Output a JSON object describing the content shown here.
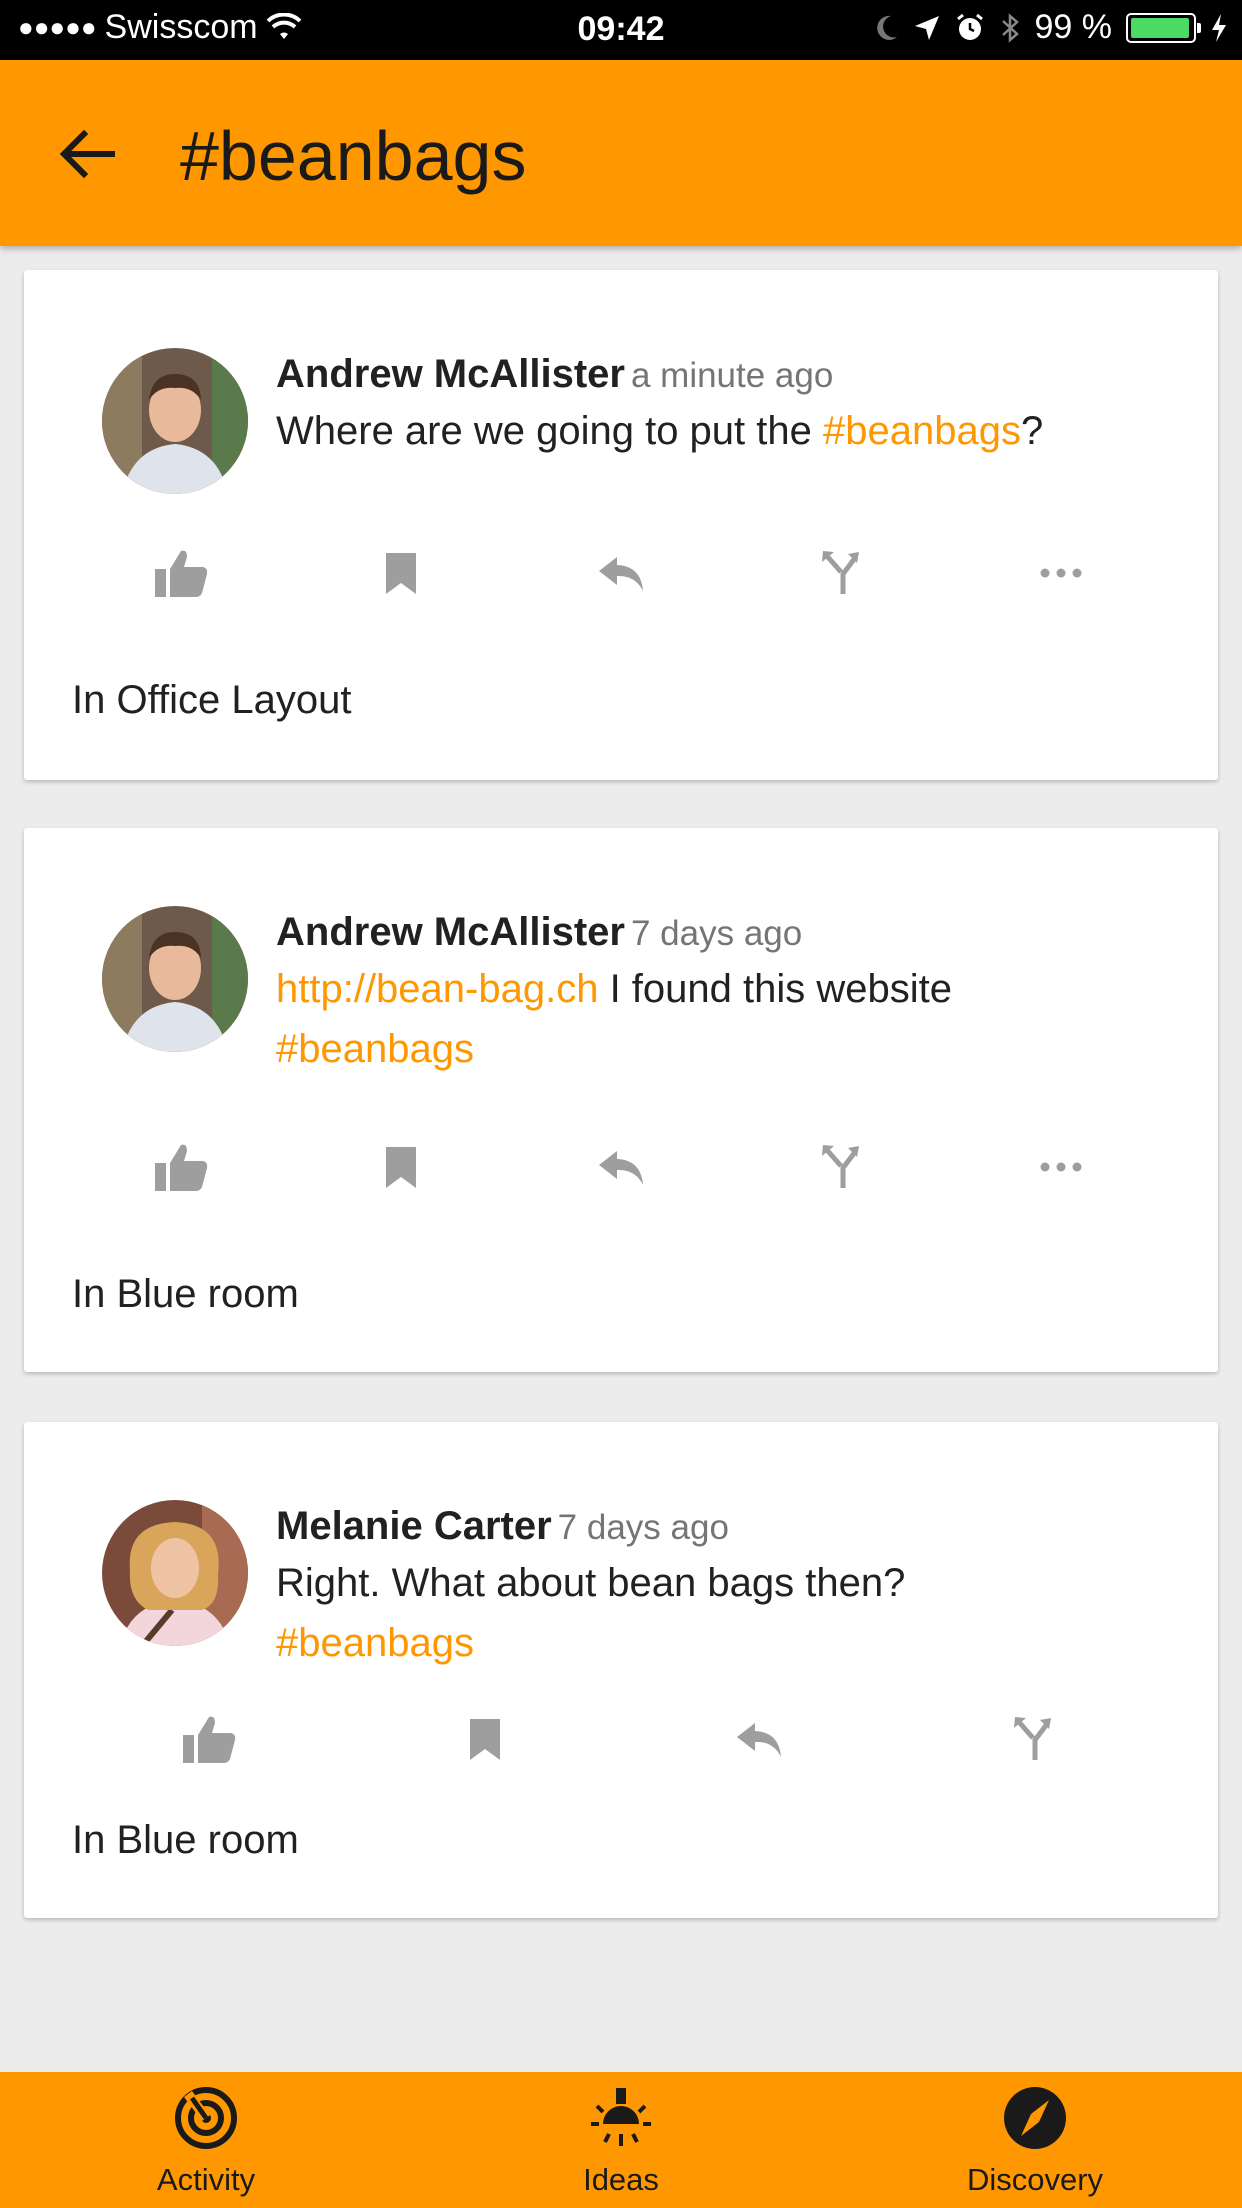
{
  "status_bar": {
    "carrier": "Swisscom",
    "time": "09:42",
    "battery": "99 %"
  },
  "app_bar": {
    "title": "#beanbags"
  },
  "posts": [
    {
      "author": "Andrew McAllister",
      "time": "a minute ago",
      "text_before": "Where are we going to put the ",
      "hashtag": "#beanbags",
      "text_after": "?",
      "location": "In Office Layout"
    },
    {
      "author": "Andrew McAllister",
      "time": "7 days ago",
      "link": "http://bean-bag.ch",
      "text": " I found this website",
      "hashtag": "#beanbags",
      "location": "In Blue room"
    },
    {
      "author": "Melanie Carter",
      "time": "7 days ago",
      "text": "Right. What about bean bags then?",
      "hashtag": "#beanbags",
      "location": "In Blue room"
    }
  ],
  "bottom_nav": {
    "items": [
      {
        "label": "Activity",
        "icon": "activity-icon"
      },
      {
        "label": "Ideas",
        "icon": "ideas-icon"
      },
      {
        "label": "Discovery",
        "icon": "discovery-icon"
      }
    ]
  },
  "colors": {
    "accent": "#ff9800",
    "icon_grey": "#9e9e9e",
    "background": "#ececec"
  }
}
